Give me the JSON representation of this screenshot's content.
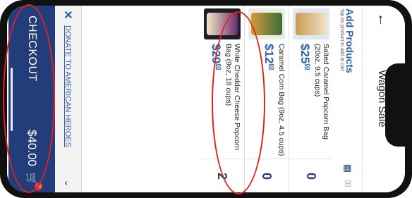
{
  "app": {
    "title": "Wagon Sale",
    "back_icon": "arrow-left-icon"
  },
  "add_products": {
    "title": "Add Products",
    "subtitle": "Tap on product to add to cart"
  },
  "products": [
    {
      "name": "Salted Caramel Popcorn Bag (20oz, 9.5 cups)",
      "price_dollars": "$25",
      "price_cents": "00",
      "quantity": "0"
    },
    {
      "name": "Caramel Corn Bag (9oz, 4.5 cups)",
      "price_dollars": "$12",
      "price_cents": "00",
      "quantity": "0"
    },
    {
      "name": "White Cheddar Cheese Popcorn Bag (9oz, 18 cups)",
      "price_dollars": "$20",
      "price_cents": "00",
      "quantity": "2"
    }
  ],
  "donate": {
    "label": "DONATE TO AMERICAN HEROES"
  },
  "checkout": {
    "label": "CHECKOUT",
    "total": "$40.00",
    "cart_count": "2"
  },
  "colors": {
    "brand_blue": "#233d7a",
    "link_blue": "#2f5fa7",
    "annotation_red": "#e2231a"
  }
}
